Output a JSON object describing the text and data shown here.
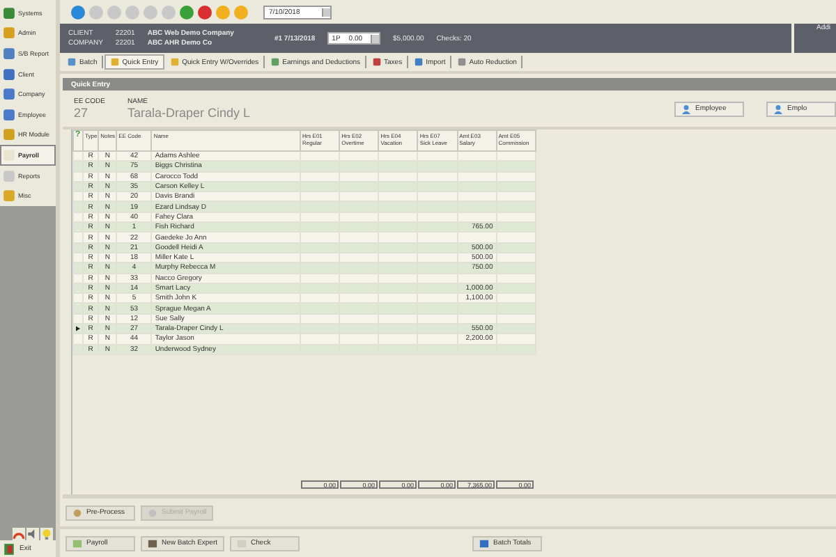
{
  "sidebar": {
    "items": [
      {
        "label": "Systems",
        "selected": false
      },
      {
        "label": "Admin",
        "selected": false
      },
      {
        "label": "S/B Report",
        "selected": false
      },
      {
        "label": "Client",
        "selected": false
      },
      {
        "label": "Company",
        "selected": false
      },
      {
        "label": "Employee",
        "selected": false
      },
      {
        "label": "HR Module",
        "selected": false
      },
      {
        "label": "Payroll",
        "selected": true
      },
      {
        "label": "Reports",
        "selected": false
      },
      {
        "label": "Misc",
        "selected": false
      }
    ],
    "exit": "Exit"
  },
  "toolbar": {
    "date": "7/10/2018"
  },
  "header": {
    "client_label": "CLIENT",
    "client": "22201",
    "company_label": "COMPANY",
    "company": "22201",
    "client_name": "ABC Web Demo Company",
    "company_name": "ABC AHR Demo Co",
    "batch": "#1 7/13/2018",
    "period": "1P",
    "period_amount": "0.00",
    "amount": "$5,000.00",
    "checks": "Checks: 20",
    "side": "Addi"
  },
  "tabs": [
    {
      "label": "Batch",
      "selected": false
    },
    {
      "label": "Quick Entry",
      "selected": true
    },
    {
      "label": "Quick Entry W/Overrides",
      "selected": false
    },
    {
      "label": "Earnings and Deductions",
      "selected": false
    },
    {
      "label": "Taxes",
      "selected": false
    },
    {
      "label": "Import",
      "selected": false
    },
    {
      "label": "Auto Reduction",
      "selected": false
    }
  ],
  "panel": {
    "title": "Quick Entry",
    "ee_code_label": "EE CODE",
    "ee_code": "27",
    "name_label": "NAME",
    "name": "Tarala-Draper Cindy L",
    "buttons": [
      "Employee",
      "Emplo"
    ]
  },
  "table": {
    "columns": [
      {
        "line1": "?"
      },
      {
        "line1": "Type"
      },
      {
        "line1": "Notes"
      },
      {
        "line1": "EE Code"
      },
      {
        "line1": "Name"
      },
      {
        "line1": "Hrs E01",
        "line2": "Regular"
      },
      {
        "line1": "Hrs E02",
        "line2": "Overtime"
      },
      {
        "line1": "Hrs E04",
        "line2": "Vacation"
      },
      {
        "line1": "Hrs E07",
        "line2": "Sick Leave"
      },
      {
        "line1": "Amt E03",
        "line2": "Salary"
      },
      {
        "line1": "Amt E05",
        "line2": "Commission"
      }
    ],
    "rows": [
      {
        "type": "R",
        "notes": "N",
        "code": "42",
        "name": "Adams Ashlee",
        "salary": "",
        "current": false
      },
      {
        "type": "R",
        "notes": "N",
        "code": "75",
        "name": "Biggs Christina",
        "salary": "",
        "current": false
      },
      {
        "type": "R",
        "notes": "N",
        "code": "68",
        "name": "Carocco Todd",
        "salary": "",
        "current": false
      },
      {
        "type": "R",
        "notes": "N",
        "code": "35",
        "name": "Carson Kelley L",
        "salary": "",
        "current": false
      },
      {
        "type": "R",
        "notes": "N",
        "code": "20",
        "name": "Davis Brandi",
        "salary": "",
        "current": false
      },
      {
        "type": "R",
        "notes": "N",
        "code": "19",
        "name": "Ezard Lindsay D",
        "salary": "",
        "current": false
      },
      {
        "type": "R",
        "notes": "N",
        "code": "40",
        "name": "Fahey Clara",
        "salary": "",
        "current": false
      },
      {
        "type": "R",
        "notes": "N",
        "code": "1",
        "name": "Fish Richard",
        "salary": "765.00",
        "current": false
      },
      {
        "type": "R",
        "notes": "N",
        "code": "22",
        "name": "Gaedeke Jo Ann",
        "salary": "",
        "current": false
      },
      {
        "type": "R",
        "notes": "N",
        "code": "21",
        "name": "Goodell Heidi A",
        "salary": "500.00",
        "current": false
      },
      {
        "type": "R",
        "notes": "N",
        "code": "18",
        "name": "Miller Kate L",
        "salary": "500.00",
        "current": false
      },
      {
        "type": "R",
        "notes": "N",
        "code": "4",
        "name": "Murphy Rebecca M",
        "salary": "750.00",
        "current": false
      },
      {
        "type": "R",
        "notes": "N",
        "code": "33",
        "name": "Nacco Gregory",
        "salary": "",
        "current": false
      },
      {
        "type": "R",
        "notes": "N",
        "code": "14",
        "name": "Smart Lacy",
        "salary": "1,000.00",
        "current": false
      },
      {
        "type": "R",
        "notes": "N",
        "code": "5",
        "name": "Smith John K",
        "salary": "1,100.00",
        "current": false
      },
      {
        "type": "R",
        "notes": "N",
        "code": "53",
        "name": "Sprague Megan A",
        "salary": "",
        "current": false
      },
      {
        "type": "R",
        "notes": "N",
        "code": "12",
        "name": "Sue Sally",
        "salary": "",
        "current": false
      },
      {
        "type": "R",
        "notes": "N",
        "code": "27",
        "name": "Tarala-Draper Cindy L",
        "salary": "550.00",
        "current": true
      },
      {
        "type": "R",
        "notes": "N",
        "code": "44",
        "name": "Taylor Jason",
        "salary": "2,200.00",
        "current": false
      },
      {
        "type": "R",
        "notes": "N",
        "code": "32",
        "name": "Underwood Sydney",
        "salary": "",
        "current": false
      }
    ],
    "totals": [
      "0.00",
      "0.00",
      "0.00",
      "0.00",
      "7,365.00",
      "0.00"
    ]
  },
  "actions": [
    {
      "label": "Pre-Process",
      "disabled": false
    },
    {
      "label": "Submit Payroll",
      "disabled": true
    }
  ],
  "footer_buttons": [
    "Payroll",
    "New Batch Expert",
    "Check",
    "Batch Totals"
  ]
}
